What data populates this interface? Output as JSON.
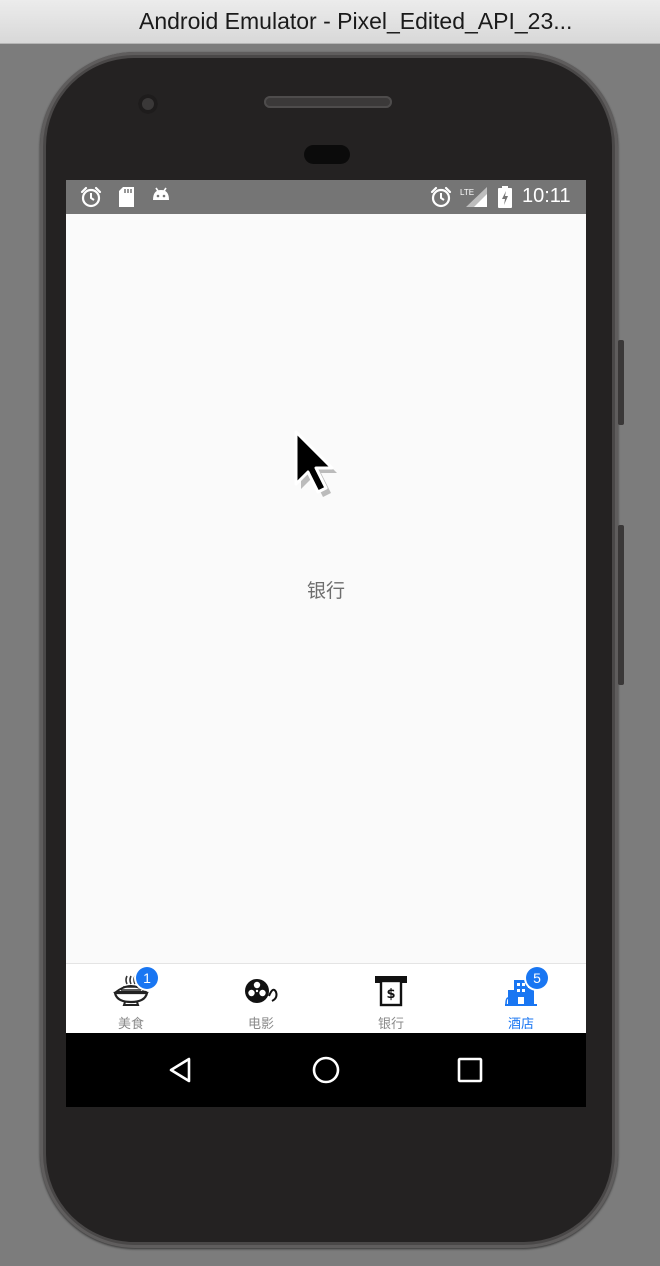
{
  "window": {
    "title": "Android Emulator - Pixel_Edited_API_23..."
  },
  "statusbar": {
    "left_icons": [
      "alarm-icon",
      "sd-card-icon",
      "android-icon"
    ],
    "right_icons": [
      "alarm-icon",
      "lte-signal-icon",
      "battery-charging-icon"
    ],
    "network_label": "LTE",
    "time": "10:11"
  },
  "main": {
    "label": "银行"
  },
  "bottom_nav": {
    "accent_color": "#1976f2",
    "active_tab": "酒店",
    "tabs": [
      {
        "label": "美食",
        "icon": "noodle-bowl-icon",
        "badge": "1"
      },
      {
        "label": "电影",
        "icon": "film-reel-icon",
        "badge": ""
      },
      {
        "label": "银行",
        "icon": "atm-cash-icon",
        "badge": ""
      },
      {
        "label": "酒店",
        "icon": "hotel-building-icon",
        "badge": "5"
      }
    ]
  },
  "navbar": {
    "icons": [
      "back-icon",
      "home-icon",
      "recents-icon"
    ]
  }
}
